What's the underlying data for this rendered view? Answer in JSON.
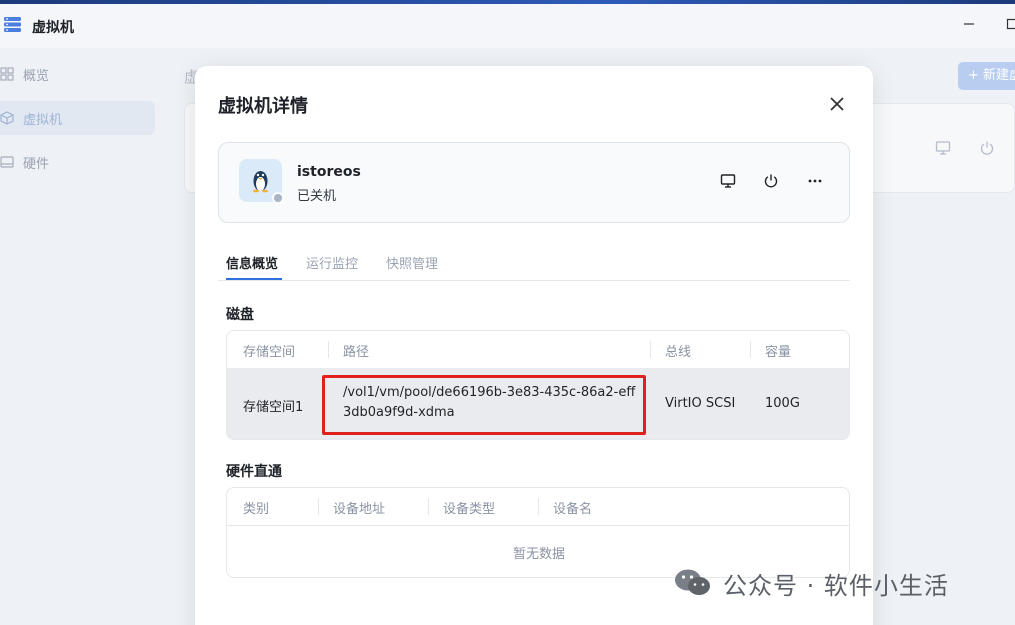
{
  "app": {
    "title": "虚拟机",
    "window_controls": [
      "minimize-icon",
      "maximize-icon"
    ]
  },
  "sidebar": {
    "items": [
      {
        "label": "概览",
        "icon": "grid-icon",
        "active": false
      },
      {
        "label": "虚拟机",
        "icon": "cube-icon",
        "active": true
      },
      {
        "label": "硬件",
        "icon": "drive-icon",
        "active": false
      }
    ]
  },
  "background": {
    "title_fragment": "虚",
    "new_button": "+ 新建虚"
  },
  "modal": {
    "title": "虚拟机详情",
    "vm": {
      "name": "istoreos",
      "status": "已关机",
      "status_color": "#a9b3c2",
      "icon": "linux-penguin-icon"
    },
    "tabs": [
      {
        "label": "信息概览",
        "active": true
      },
      {
        "label": "运行监控",
        "active": false
      },
      {
        "label": "快照管理",
        "active": false
      }
    ],
    "disk": {
      "section_title": "磁盘",
      "headers": [
        "存储空间",
        "路径",
        "总线",
        "容量"
      ],
      "rows": [
        {
          "storage": "存储空间1",
          "path": "/vol1/vm/pool/de66196b-3e83-435c-86a2-eff3db0a9f9d-xdma",
          "bus": "VirtIO SCSI",
          "capacity": "100G"
        }
      ]
    },
    "passthrough": {
      "section_title": "硬件直通",
      "headers": [
        "类别",
        "设备地址",
        "设备类型",
        "设备名"
      ],
      "empty_text": "暂无数据"
    }
  },
  "watermark": {
    "text": "公众号 · 软件小生活"
  },
  "colors": {
    "accent": "#2f6fde",
    "highlight_border": "#e0201c",
    "sidebar_bg": "#eef1f5"
  }
}
